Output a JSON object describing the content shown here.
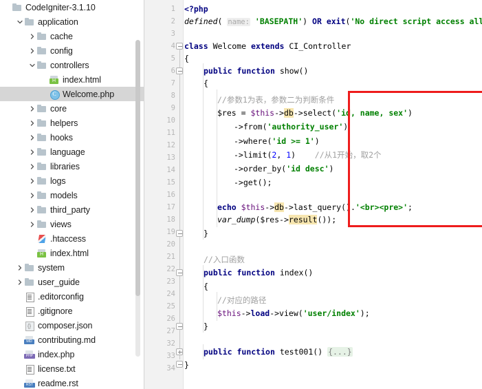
{
  "sidebar": {
    "root": {
      "label": "CodeIgniter-3.1.10",
      "icon": "folder-icon"
    },
    "items": [
      {
        "label": "application",
        "icon": "folder-icon",
        "depth": 1,
        "arrow": "down",
        "type": "folder"
      },
      {
        "label": "cache",
        "icon": "folder-icon",
        "depth": 2,
        "arrow": "right",
        "type": "folder"
      },
      {
        "label": "config",
        "icon": "folder-icon",
        "depth": 2,
        "arrow": "right",
        "type": "folder"
      },
      {
        "label": "controllers",
        "icon": "folder-icon",
        "depth": 2,
        "arrow": "down",
        "type": "folder"
      },
      {
        "label": "index.html",
        "icon": "html-file-icon",
        "depth": 3,
        "arrow": "none",
        "type": "file"
      },
      {
        "label": "Welcome.php",
        "icon": "php-class-icon",
        "depth": 3,
        "arrow": "none",
        "type": "file",
        "selected": true
      },
      {
        "label": "core",
        "icon": "folder-icon",
        "depth": 2,
        "arrow": "right",
        "type": "folder"
      },
      {
        "label": "helpers",
        "icon": "folder-icon",
        "depth": 2,
        "arrow": "right",
        "type": "folder"
      },
      {
        "label": "hooks",
        "icon": "folder-icon",
        "depth": 2,
        "arrow": "right",
        "type": "folder"
      },
      {
        "label": "language",
        "icon": "folder-icon",
        "depth": 2,
        "arrow": "right",
        "type": "folder"
      },
      {
        "label": "libraries",
        "icon": "folder-icon",
        "depth": 2,
        "arrow": "right",
        "type": "folder"
      },
      {
        "label": "logs",
        "icon": "folder-icon",
        "depth": 2,
        "arrow": "right",
        "type": "folder"
      },
      {
        "label": "models",
        "icon": "folder-icon",
        "depth": 2,
        "arrow": "right",
        "type": "folder"
      },
      {
        "label": "third_party",
        "icon": "folder-icon",
        "depth": 2,
        "arrow": "right",
        "type": "folder"
      },
      {
        "label": "views",
        "icon": "folder-icon",
        "depth": 2,
        "arrow": "right",
        "type": "folder"
      },
      {
        "label": ".htaccess",
        "icon": "htaccess-file-icon",
        "depth": 2,
        "arrow": "none",
        "type": "file"
      },
      {
        "label": "index.html",
        "icon": "html-file-icon",
        "depth": 2,
        "arrow": "none",
        "type": "file"
      },
      {
        "label": "system",
        "icon": "folder-icon",
        "depth": 1,
        "arrow": "right",
        "type": "folder"
      },
      {
        "label": "user_guide",
        "icon": "folder-icon",
        "depth": 1,
        "arrow": "right",
        "type": "folder"
      },
      {
        "label": ".editorconfig",
        "icon": "text-file-icon",
        "depth": 1,
        "arrow": "none",
        "type": "file"
      },
      {
        "label": ".gitignore",
        "icon": "text-file-icon",
        "depth": 1,
        "arrow": "none",
        "type": "file"
      },
      {
        "label": "composer.json",
        "icon": "json-file-icon",
        "depth": 1,
        "arrow": "none",
        "type": "file"
      },
      {
        "label": "contributing.md",
        "icon": "md-file-icon",
        "depth": 1,
        "arrow": "none",
        "type": "file"
      },
      {
        "label": "index.php",
        "icon": "php-file-icon",
        "depth": 1,
        "arrow": "none",
        "type": "file"
      },
      {
        "label": "license.txt",
        "icon": "text-file-icon",
        "depth": 1,
        "arrow": "none",
        "type": "file"
      },
      {
        "label": "readme.rst",
        "icon": "rst-file-icon",
        "depth": 1,
        "arrow": "none",
        "type": "file"
      }
    ]
  },
  "editor": {
    "line_numbers": [
      1,
      2,
      3,
      4,
      5,
      6,
      7,
      8,
      9,
      10,
      11,
      12,
      13,
      14,
      15,
      16,
      17,
      18,
      19,
      20,
      21,
      22,
      23,
      24,
      25,
      26,
      27,
      32,
      33,
      34
    ],
    "annotation_box_color": "#ee1c1c",
    "code": {
      "l1_php_open": "<?php",
      "l2_defined": "defined",
      "l2_param_hint": "name:",
      "l2_basepath": "'BASEPATH'",
      "l2_or": "OR",
      "l2_exit": "exit",
      "l2_msg": "'No direct script access allowed'",
      "l4_class": "class",
      "l4_name": "Welcome",
      "l4_extends": "extends",
      "l4_parent": "CI_Controller",
      "l6_public": "public",
      "l6_function": "function",
      "l6_show": "show",
      "l8_comment": "//参数1为表，参数二为判断条件",
      "l9_res": "$res",
      "l9_this": "$this",
      "l9_db": "db",
      "l9_select": "select",
      "l9_cols": "'id, name, sex'",
      "l10_from": "from",
      "l10_table": "'authority_user'",
      "l11_where": "where",
      "l11_cond": "'id >= 1'",
      "l12_limit": "limit",
      "l12_a": "2",
      "l12_b": "1",
      "l12_comment": "//从1开始，取2个",
      "l13_order": "order_by",
      "l13_arg": "'id desc'",
      "l14_get": "get",
      "l16_echo": "echo",
      "l16_this": "$this",
      "l16_db": "db",
      "l16_last_query": "last_query",
      "l16_str": "'<br><pre>'",
      "l17_var_dump": "var_dump",
      "l17_res": "$res",
      "l17_result": "result",
      "l20_comment": "//入口函数",
      "l21_public": "public",
      "l21_function": "function",
      "l21_index": "index",
      "l23_comment": "//对应的路径",
      "l24_this": "$this",
      "l24_load": "load",
      "l24_view": "view",
      "l24_path": "'user/index'",
      "l27_public": "public",
      "l27_function": "function",
      "l27_test": "test001",
      "l27_folded": "{...}"
    }
  }
}
